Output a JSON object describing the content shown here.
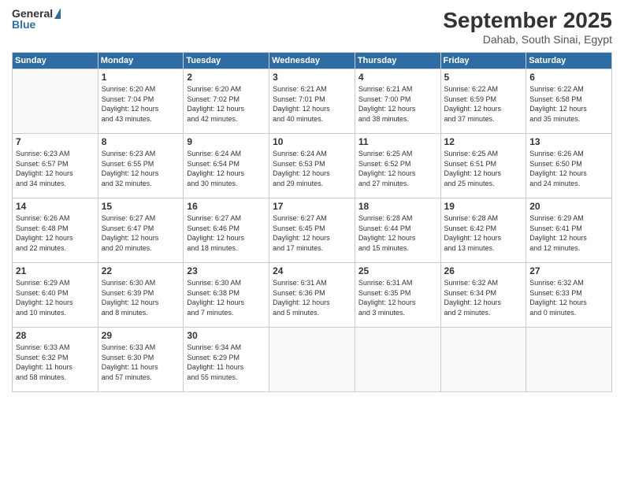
{
  "logo": {
    "general": "General",
    "blue": "Blue"
  },
  "header": {
    "month": "September 2025",
    "location": "Dahab, South Sinai, Egypt"
  },
  "days_of_week": [
    "Sunday",
    "Monday",
    "Tuesday",
    "Wednesday",
    "Thursday",
    "Friday",
    "Saturday"
  ],
  "weeks": [
    [
      {
        "day": "",
        "content": ""
      },
      {
        "day": "1",
        "content": "Sunrise: 6:20 AM\nSunset: 7:04 PM\nDaylight: 12 hours\nand 43 minutes."
      },
      {
        "day": "2",
        "content": "Sunrise: 6:20 AM\nSunset: 7:02 PM\nDaylight: 12 hours\nand 42 minutes."
      },
      {
        "day": "3",
        "content": "Sunrise: 6:21 AM\nSunset: 7:01 PM\nDaylight: 12 hours\nand 40 minutes."
      },
      {
        "day": "4",
        "content": "Sunrise: 6:21 AM\nSunset: 7:00 PM\nDaylight: 12 hours\nand 38 minutes."
      },
      {
        "day": "5",
        "content": "Sunrise: 6:22 AM\nSunset: 6:59 PM\nDaylight: 12 hours\nand 37 minutes."
      },
      {
        "day": "6",
        "content": "Sunrise: 6:22 AM\nSunset: 6:58 PM\nDaylight: 12 hours\nand 35 minutes."
      }
    ],
    [
      {
        "day": "7",
        "content": "Sunrise: 6:23 AM\nSunset: 6:57 PM\nDaylight: 12 hours\nand 34 minutes."
      },
      {
        "day": "8",
        "content": "Sunrise: 6:23 AM\nSunset: 6:55 PM\nDaylight: 12 hours\nand 32 minutes."
      },
      {
        "day": "9",
        "content": "Sunrise: 6:24 AM\nSunset: 6:54 PM\nDaylight: 12 hours\nand 30 minutes."
      },
      {
        "day": "10",
        "content": "Sunrise: 6:24 AM\nSunset: 6:53 PM\nDaylight: 12 hours\nand 29 minutes."
      },
      {
        "day": "11",
        "content": "Sunrise: 6:25 AM\nSunset: 6:52 PM\nDaylight: 12 hours\nand 27 minutes."
      },
      {
        "day": "12",
        "content": "Sunrise: 6:25 AM\nSunset: 6:51 PM\nDaylight: 12 hours\nand 25 minutes."
      },
      {
        "day": "13",
        "content": "Sunrise: 6:26 AM\nSunset: 6:50 PM\nDaylight: 12 hours\nand 24 minutes."
      }
    ],
    [
      {
        "day": "14",
        "content": "Sunrise: 6:26 AM\nSunset: 6:48 PM\nDaylight: 12 hours\nand 22 minutes."
      },
      {
        "day": "15",
        "content": "Sunrise: 6:27 AM\nSunset: 6:47 PM\nDaylight: 12 hours\nand 20 minutes."
      },
      {
        "day": "16",
        "content": "Sunrise: 6:27 AM\nSunset: 6:46 PM\nDaylight: 12 hours\nand 18 minutes."
      },
      {
        "day": "17",
        "content": "Sunrise: 6:27 AM\nSunset: 6:45 PM\nDaylight: 12 hours\nand 17 minutes."
      },
      {
        "day": "18",
        "content": "Sunrise: 6:28 AM\nSunset: 6:44 PM\nDaylight: 12 hours\nand 15 minutes."
      },
      {
        "day": "19",
        "content": "Sunrise: 6:28 AM\nSunset: 6:42 PM\nDaylight: 12 hours\nand 13 minutes."
      },
      {
        "day": "20",
        "content": "Sunrise: 6:29 AM\nSunset: 6:41 PM\nDaylight: 12 hours\nand 12 minutes."
      }
    ],
    [
      {
        "day": "21",
        "content": "Sunrise: 6:29 AM\nSunset: 6:40 PM\nDaylight: 12 hours\nand 10 minutes."
      },
      {
        "day": "22",
        "content": "Sunrise: 6:30 AM\nSunset: 6:39 PM\nDaylight: 12 hours\nand 8 minutes."
      },
      {
        "day": "23",
        "content": "Sunrise: 6:30 AM\nSunset: 6:38 PM\nDaylight: 12 hours\nand 7 minutes."
      },
      {
        "day": "24",
        "content": "Sunrise: 6:31 AM\nSunset: 6:36 PM\nDaylight: 12 hours\nand 5 minutes."
      },
      {
        "day": "25",
        "content": "Sunrise: 6:31 AM\nSunset: 6:35 PM\nDaylight: 12 hours\nand 3 minutes."
      },
      {
        "day": "26",
        "content": "Sunrise: 6:32 AM\nSunset: 6:34 PM\nDaylight: 12 hours\nand 2 minutes."
      },
      {
        "day": "27",
        "content": "Sunrise: 6:32 AM\nSunset: 6:33 PM\nDaylight: 12 hours\nand 0 minutes."
      }
    ],
    [
      {
        "day": "28",
        "content": "Sunrise: 6:33 AM\nSunset: 6:32 PM\nDaylight: 11 hours\nand 58 minutes."
      },
      {
        "day": "29",
        "content": "Sunrise: 6:33 AM\nSunset: 6:30 PM\nDaylight: 11 hours\nand 57 minutes."
      },
      {
        "day": "30",
        "content": "Sunrise: 6:34 AM\nSunset: 6:29 PM\nDaylight: 11 hours\nand 55 minutes."
      },
      {
        "day": "",
        "content": ""
      },
      {
        "day": "",
        "content": ""
      },
      {
        "day": "",
        "content": ""
      },
      {
        "day": "",
        "content": ""
      }
    ]
  ]
}
